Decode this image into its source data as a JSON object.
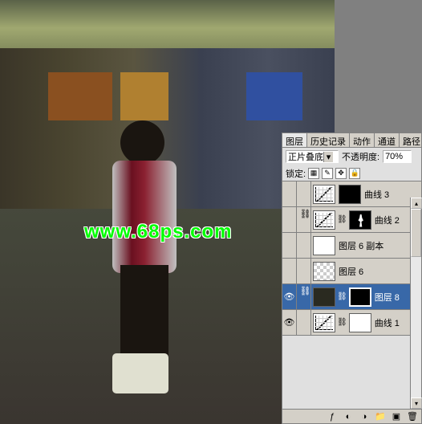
{
  "watermark": "www.68ps.com",
  "panel": {
    "tabs": [
      "图层",
      "历史记录",
      "动作",
      "通道",
      "路径"
    ],
    "blend_mode": "正片叠底",
    "opacity_label": "不透明度:",
    "opacity_value": "70%",
    "lock_label": "锁定:",
    "layers": [
      {
        "name": "曲线 3",
        "type": "curves",
        "mask": "black",
        "visible": false
      },
      {
        "name": "曲线 2",
        "type": "curves",
        "mask": "mask-fig",
        "visible": false,
        "linked": true
      },
      {
        "name": "图层 6 副本",
        "type": "checker-fig",
        "visible": false
      },
      {
        "name": "图层 6",
        "type": "checker",
        "visible": false
      },
      {
        "name": "图层 8",
        "type": "image",
        "mask": "black",
        "visible": true,
        "selected": true,
        "linked": true
      },
      {
        "name": "曲线 1",
        "type": "curves",
        "mask": "white",
        "visible": true
      }
    ]
  }
}
